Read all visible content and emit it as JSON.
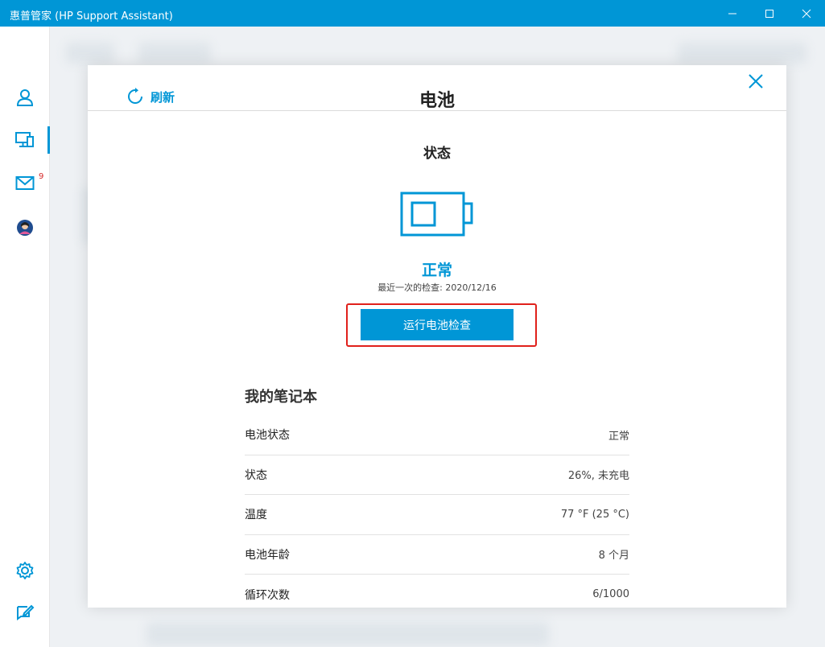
{
  "window": {
    "title": "惠普管家 (HP Support Assistant)"
  },
  "sidebar": {
    "items": [
      {
        "icon": "person-icon"
      },
      {
        "icon": "device-icon",
        "active": true
      },
      {
        "icon": "mail-icon",
        "badge": "9"
      },
      {
        "icon": "avatar-icon"
      }
    ],
    "bottom": [
      {
        "icon": "gear-icon"
      },
      {
        "icon": "feedback-icon"
      }
    ]
  },
  "dialog": {
    "refresh_label": "刷新",
    "title": "电池",
    "status_heading": "状态",
    "status_value": "正常",
    "last_check": "最近一次的检查: 2020/12/16",
    "run_button": "运行电池检查",
    "section_title": "我的笔记本",
    "rows": [
      {
        "label": "电池状态",
        "value": "正常"
      },
      {
        "label": "状态",
        "value": "26%, 未充电"
      },
      {
        "label": "温度",
        "value": "77 °F (25 °C)"
      },
      {
        "label": "电池年龄",
        "value": "8 个月"
      },
      {
        "label": "循环次数",
        "value": "6/1000"
      }
    ]
  },
  "colors": {
    "accent": "#0096d6",
    "highlight": "#e0201b",
    "badge": "#d62828"
  }
}
